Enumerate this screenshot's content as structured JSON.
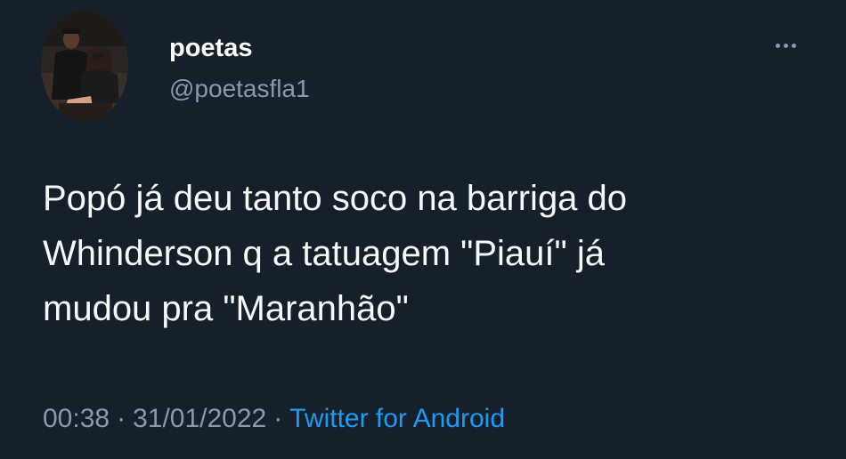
{
  "tweet": {
    "author": {
      "display_name": "poetas",
      "handle": "@poetasfla1",
      "avatar": "profile-photo"
    },
    "more_icon": "more-horizontal-icon",
    "text": "Popó já deu tanto soco na barriga do\nWhinderson q a tatuagem \"Piauí\" já\nmudou pra \"Maranhão\"",
    "time": "00:38",
    "separator": "·",
    "date": "31/01/2022",
    "source": "Twitter for Android"
  },
  "colors": {
    "background": "#15202b",
    "text_primary": "#f7f9f9",
    "text_secondary": "#8b98a5",
    "link": "#1d9bf0"
  }
}
